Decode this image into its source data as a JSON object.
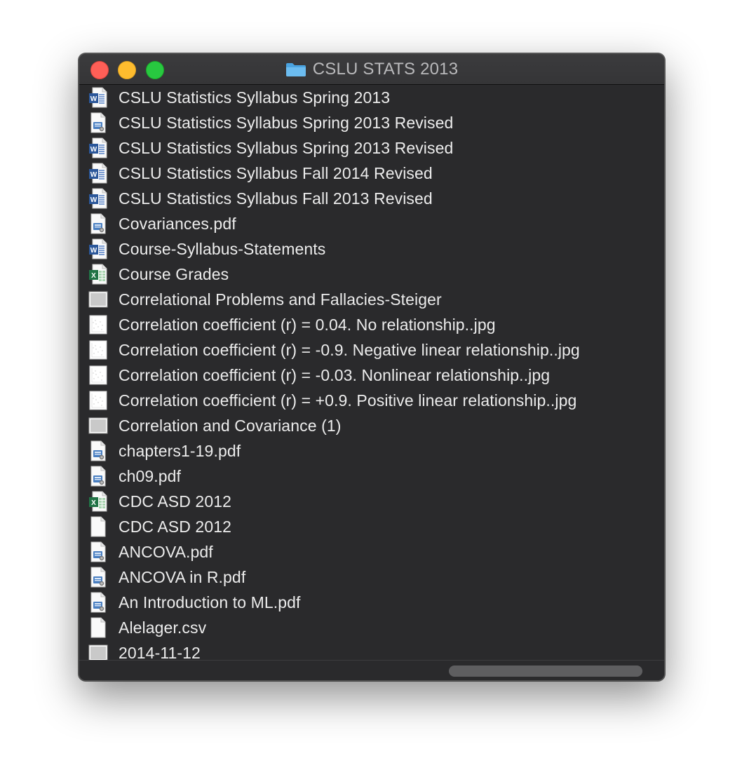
{
  "window": {
    "title": "CSLU STATS 2013",
    "title_icon": "folder-icon",
    "accent_color": "#5aa9e6"
  },
  "files": [
    {
      "name": "CSLU Statistics Syllabus Spring 2013",
      "icon": "word-doc-icon"
    },
    {
      "name": "CSLU Statistics Syllabus Spring 2013 Revised",
      "icon": "pdf-doc-icon"
    },
    {
      "name": "CSLU Statistics Syllabus Spring 2013 Revised",
      "icon": "word-doc-icon"
    },
    {
      "name": "CSLU Statistics Syllabus Fall 2014 Revised",
      "icon": "word-doc-icon"
    },
    {
      "name": "CSLU Statistics Syllabus Fall 2013 Revised",
      "icon": "word-doc-icon"
    },
    {
      "name": "Covariances.pdf",
      "icon": "pdf-doc-icon"
    },
    {
      "name": "Course-Syllabus-Statements",
      "icon": "word-doc-icon"
    },
    {
      "name": "Course Grades",
      "icon": "excel-doc-icon"
    },
    {
      "name": "Correlational Problems and Fallacies-Steiger",
      "icon": "presentation-icon"
    },
    {
      "name": "Correlation coefficient (r) = 0.04. No relationship..jpg",
      "icon": "image-thumbnail-icon"
    },
    {
      "name": "Correlation coefficient (r) = -0.9. Negative linear relationship..jpg",
      "icon": "image-thumbnail-icon"
    },
    {
      "name": "Correlation coefficient (r) = -0.03. Nonlinear relationship..jpg",
      "icon": "image-thumbnail-icon"
    },
    {
      "name": "Correlation coefficient (r) = +0.9. Positive linear relationship..jpg",
      "icon": "image-thumbnail-icon"
    },
    {
      "name": "Correlation and Covariance (1)",
      "icon": "presentation-icon"
    },
    {
      "name": "chapters1-19.pdf",
      "icon": "pdf-doc-icon"
    },
    {
      "name": "ch09.pdf",
      "icon": "pdf-doc-icon"
    },
    {
      "name": "CDC ASD 2012",
      "icon": "excel-doc-icon"
    },
    {
      "name": "CDC ASD 2012",
      "icon": "blank-doc-icon"
    },
    {
      "name": "ANCOVA.pdf",
      "icon": "pdf-doc-icon"
    },
    {
      "name": "ANCOVA in R.pdf",
      "icon": "pdf-doc-icon"
    },
    {
      "name": "An Introduction to ML.pdf",
      "icon": "pdf-doc-icon"
    },
    {
      "name": "Alelager.csv",
      "icon": "blank-doc-icon"
    },
    {
      "name": "2014-11-12",
      "icon": "presentation-icon"
    }
  ]
}
